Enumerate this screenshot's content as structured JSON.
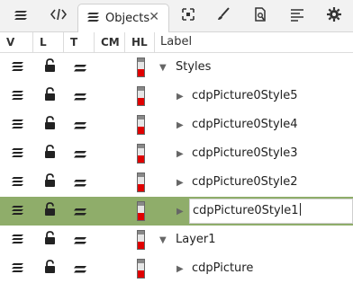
{
  "tabs": {
    "active_label": "Objects",
    "close_glyph": "✕",
    "icons": [
      "layers-icon",
      "xml-editor-icon",
      "objects-icon",
      "align-icon",
      "paint-brush-icon",
      "document-properties-icon",
      "text-align-icon",
      "settings-icon"
    ]
  },
  "columns": [
    "V",
    "L",
    "T",
    "CM",
    "HL",
    "Label"
  ],
  "rows": [
    {
      "label": "Styles",
      "indent": 0,
      "expanded": true,
      "selected": false,
      "editing": false,
      "highlight_color": "#e00000"
    },
    {
      "label": "cdpPicture0Style5",
      "indent": 1,
      "expanded": false,
      "selected": false,
      "editing": false,
      "highlight_color": "#e00000"
    },
    {
      "label": "cdpPicture0Style4",
      "indent": 1,
      "expanded": false,
      "selected": false,
      "editing": false,
      "highlight_color": "#e00000"
    },
    {
      "label": "cdpPicture0Style3",
      "indent": 1,
      "expanded": false,
      "selected": false,
      "editing": false,
      "highlight_color": "#e00000"
    },
    {
      "label": "cdpPicture0Style2",
      "indent": 1,
      "expanded": false,
      "selected": false,
      "editing": false,
      "highlight_color": "#e00000"
    },
    {
      "label": "cdpPicture0Style1",
      "indent": 1,
      "expanded": false,
      "selected": true,
      "editing": true,
      "highlight_color": "#e00000"
    },
    {
      "label": "Layer1",
      "indent": 0,
      "expanded": true,
      "selected": false,
      "editing": false,
      "highlight_color": "#e00000"
    },
    {
      "label": "cdpPicture",
      "indent": 1,
      "expanded": false,
      "selected": false,
      "editing": false,
      "highlight_color": "#e00000"
    }
  ],
  "colors": {
    "selected_row": "#8fad6a",
    "highlight": "#e00000"
  }
}
